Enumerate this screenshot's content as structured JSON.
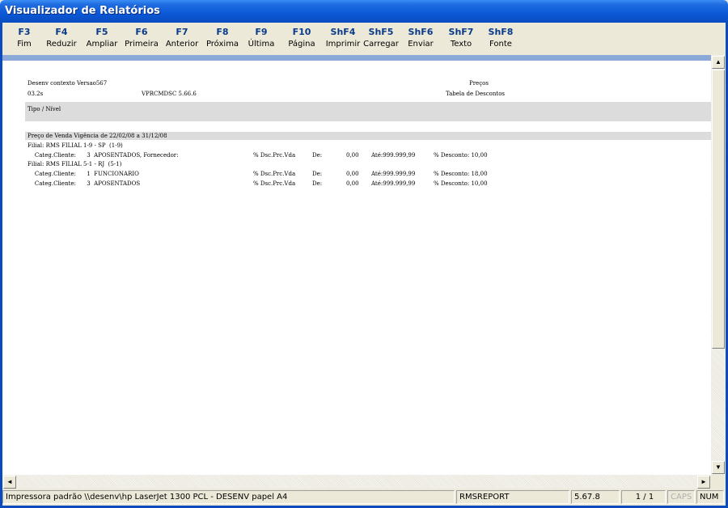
{
  "window": {
    "title": "Visualizador de Relatórios"
  },
  "toolbar": [
    {
      "key": "F3",
      "label": "Fim"
    },
    {
      "key": "F4",
      "label": "Reduzir"
    },
    {
      "key": "F5",
      "label": "Ampliar"
    },
    {
      "key": "F6",
      "label": "Primeira"
    },
    {
      "key": "F7",
      "label": "Anterior"
    },
    {
      "key": "F8",
      "label": "Próxima"
    },
    {
      "key": "F9",
      "label": "Última"
    },
    {
      "key": "F10",
      "label": "Página"
    },
    {
      "key": "ShF4",
      "label": "Imprimir"
    },
    {
      "key": "ShF5",
      "label": "Carregar"
    },
    {
      "key": "ShF6",
      "label": "Enviar"
    },
    {
      "key": "ShF7",
      "label": "Texto"
    },
    {
      "key": "ShF8",
      "label": "Fonte"
    }
  ],
  "report": {
    "header_left1": "Desenv contexto Versao567",
    "header_right1": "Preços",
    "header_left2": "03.2s",
    "header_mid2": "VPRCMDSC 5.66.6",
    "header_right2": "Tabela de Descontos",
    "section_label": "Tipo / Nível",
    "group_title": "Preço de Venda Vigência de 22/02/08 a 31/12/08",
    "lines": [
      {
        "col1": "Filial: RMS FILIAL 1-9 - SP  (1-9)",
        "col2": "",
        "col3": "",
        "col4": "",
        "col5": "",
        "col6": ""
      },
      {
        "col1": "    Categ.Cliente:      3  APOSENTADOS, Fornecedor:",
        "col2": "% Dsc.Prc.Vda",
        "col3": "De:",
        "col4": "0,00",
        "col5": "Até:999.999,99",
        "col6": "% Desconto: 10,00"
      },
      {
        "col1": "Filial: RMS FILIAL 5-1 - RJ  (5-1)",
        "col2": "",
        "col3": "",
        "col4": "",
        "col5": "",
        "col6": ""
      },
      {
        "col1": "    Categ.Cliente:      1  FUNCIONARIO",
        "col2": "% Dsc.Prc.Vda",
        "col3": "De:",
        "col4": "0,00",
        "col5": "Até:999.999,99",
        "col6": "% Desconto: 18,00"
      },
      {
        "col1": "    Categ.Cliente:      3  APOSENTADOS",
        "col2": "% Dsc.Prc.Vda",
        "col3": "De:",
        "col4": "0,00",
        "col5": "Até:999.999,99",
        "col6": "% Desconto: 10,00"
      }
    ]
  },
  "statusbar": {
    "printer": "Impressora padrão \\\\desenv\\hp LaserJet 1300 PCL - DESENV papel A4",
    "report_name": "RMSREPORT",
    "version": "5.67.8",
    "page": "1 / 1",
    "caps": "CAPS",
    "num": "NUM"
  },
  "scroll": {
    "up": "▲",
    "down": "▼",
    "left": "◄",
    "right": "►"
  }
}
